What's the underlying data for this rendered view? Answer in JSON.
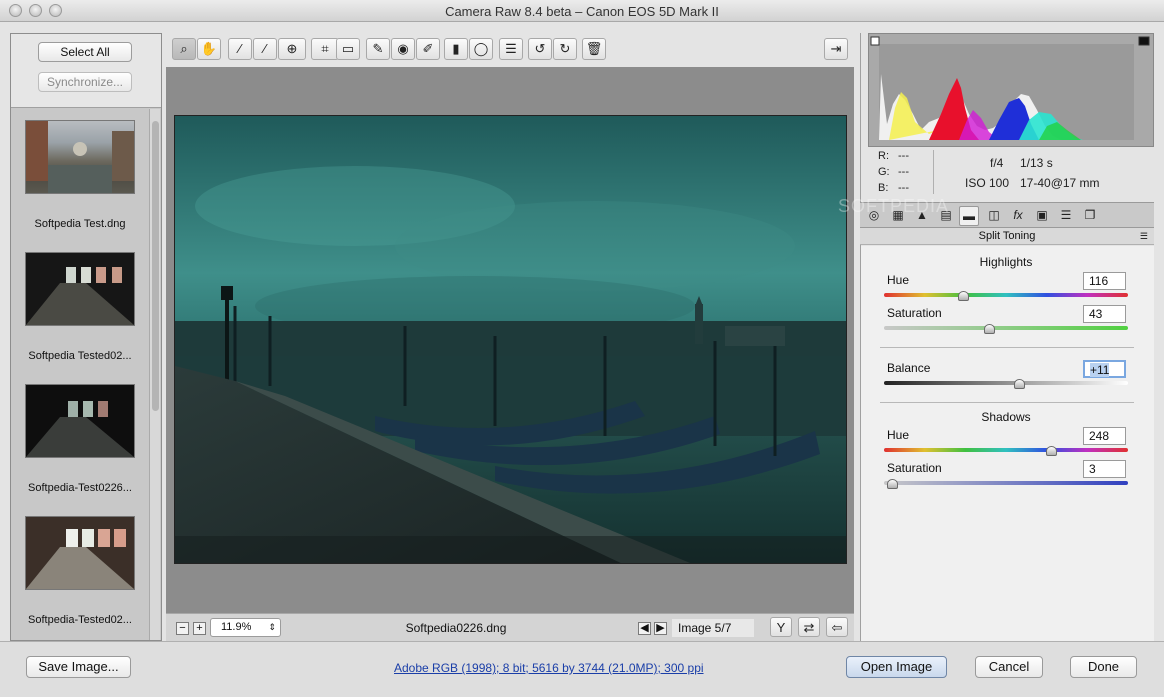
{
  "window": {
    "title": "Camera Raw 8.4 beta  –  Canon EOS 5D Mark II"
  },
  "filmstrip": {
    "select_all": "Select All",
    "synchronize": "Synchronize...",
    "thumbnails": [
      {
        "label": "Softpedia Test.dng"
      },
      {
        "label": "Softpedia Tested02..."
      },
      {
        "label": "Softpedia-Test0226..."
      },
      {
        "label": "Softpedia-Tested02..."
      }
    ]
  },
  "toolbar": {
    "tools": [
      {
        "name": "zoom-tool",
        "glyph": "🔍"
      },
      {
        "name": "hand-tool",
        "glyph": "✋"
      },
      {
        "name": "white-balance-tool",
        "glyph": "⁄"
      },
      {
        "name": "color-sampler-tool",
        "glyph": "⁄"
      },
      {
        "name": "targeted-adjustment-tool",
        "glyph": "⊕"
      },
      {
        "name": "crop-tool",
        "glyph": "⌗"
      },
      {
        "name": "straighten-tool",
        "glyph": "▭"
      },
      {
        "name": "spot-removal-tool",
        "glyph": "✎"
      },
      {
        "name": "red-eye-tool",
        "glyph": "◉"
      },
      {
        "name": "adjustment-brush-tool",
        "glyph": "✐"
      },
      {
        "name": "graduated-filter-tool",
        "glyph": "▮"
      },
      {
        "name": "radial-filter-tool",
        "glyph": "◯"
      },
      {
        "name": "preferences-tool",
        "glyph": "☰"
      },
      {
        "name": "rotate-left-tool",
        "glyph": "↺"
      },
      {
        "name": "rotate-right-tool",
        "glyph": "↻"
      },
      {
        "name": "delete-tool",
        "glyph": "🗑"
      }
    ],
    "fullscreen_glyph": "⇥"
  },
  "statusbar": {
    "zoom": "11.9%",
    "filename": "Softpedia0226.dng",
    "image_counter": "Image 5/7"
  },
  "histogram": {
    "r_label": "R:",
    "g_label": "G:",
    "b_label": "B:",
    "r_value": "---",
    "g_value": "---",
    "b_value": "---",
    "aperture": "f/4",
    "shutter": "1/13 s",
    "iso": "ISO 100",
    "lens": "17-40@17 mm"
  },
  "panel": {
    "title": "Split Toning",
    "highlights_header": "Highlights",
    "highlights_hue_label": "Hue",
    "highlights_hue_value": "116",
    "highlights_saturation_label": "Saturation",
    "highlights_saturation_value": "43",
    "balance_label": "Balance",
    "balance_value": "+11",
    "shadows_header": "Shadows",
    "shadows_hue_label": "Hue",
    "shadows_hue_value": "248",
    "shadows_saturation_label": "Saturation",
    "shadows_saturation_value": "3"
  },
  "bottom": {
    "save_image": "Save Image...",
    "workflow_link": "Adobe RGB (1998); 8 bit; 5616 by 3744 (21.0MP); 300 ppi",
    "open_image": "Open Image",
    "cancel": "Cancel",
    "done": "Done"
  },
  "colors": {
    "accent_focus": "#7aa7e0",
    "link": "#1a3ea8"
  }
}
